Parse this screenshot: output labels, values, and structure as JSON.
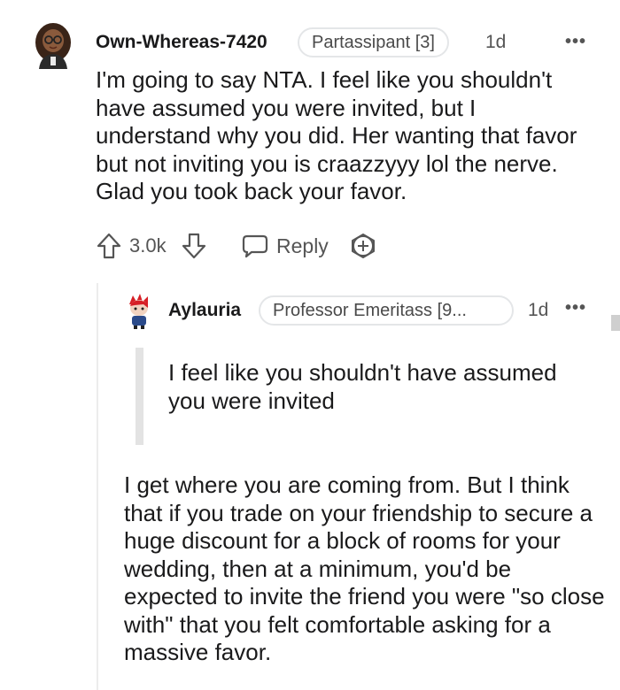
{
  "comment1": {
    "username": "Own-Whereas-7420",
    "flair": "Partassipant [3]",
    "age": "1d",
    "more": "•••",
    "body": "I'm going to say NTA. I feel like you shouldn't have assumed you were invited, but I understand why you did. Her wanting that favor but not inviting you is craazzyyy lol the nerve. Glad you took back your favor.",
    "score": "3.0k",
    "reply_label": "Reply"
  },
  "comment2": {
    "username": "Aylauria",
    "flair": "Professor Emeritass [9...",
    "age": "1d",
    "more": "•••",
    "quote": "I feel like you shouldn't have assumed you were invited",
    "body": "I get where you are coming from. But I think that if you trade on your friendship to secure a huge discount for a block of rooms for your wedding, then at a minimum, you'd be expected to invite the friend you were \"so close with\" that you felt comfortable asking for a massive favor."
  },
  "icons": {
    "upvote": "arrow-up-icon",
    "downvote": "arrow-down-icon",
    "reply": "speech-bubble-icon",
    "award": "award-plus-icon"
  },
  "colors": {
    "text": "#1a1a1b",
    "meta": "#555555",
    "flair_border": "#e4e6e8",
    "quote_bar": "#e3e3e3"
  }
}
